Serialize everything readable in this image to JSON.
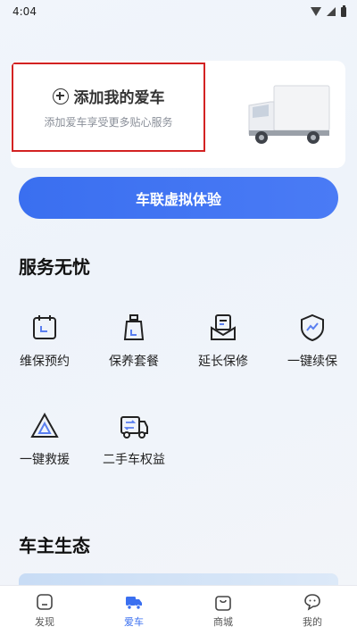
{
  "status_bar": {
    "time": "4:04"
  },
  "car_card": {
    "add_title": "添加我的爱车",
    "add_subtitle": "添加爱车享受更多贴心服务"
  },
  "virtual_button": "车联虚拟体验",
  "services": {
    "title": "服务无忧",
    "items": [
      {
        "label": "维保预约",
        "icon": "calendar-icon"
      },
      {
        "label": "保养套餐",
        "icon": "oil-bottle-icon"
      },
      {
        "label": "延长保修",
        "icon": "document-icon"
      },
      {
        "label": "一键续保",
        "icon": "shield-icon"
      },
      {
        "label": "一键救援",
        "icon": "warning-triangle-icon"
      },
      {
        "label": "二手车权益",
        "icon": "truck-exchange-icon"
      }
    ]
  },
  "ecosystem": {
    "title": "车主生态"
  },
  "tabbar": {
    "active_color": "#3a6ff0",
    "items": [
      {
        "label": "发现",
        "icon": "discover-icon"
      },
      {
        "label": "爱车",
        "icon": "truck-icon"
      },
      {
        "label": "商城",
        "icon": "shop-bag-icon"
      },
      {
        "label": "我的",
        "icon": "profile-icon"
      }
    ]
  }
}
